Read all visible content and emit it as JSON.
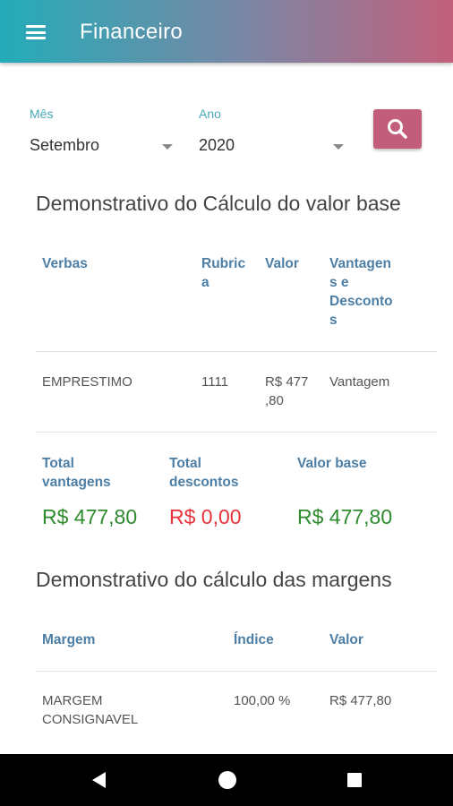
{
  "app_bar": {
    "title": "Financeiro"
  },
  "filters": {
    "month": {
      "label": "Mês",
      "value": "Setembro"
    },
    "year": {
      "label": "Ano",
      "value": "2020"
    }
  },
  "section1": {
    "title": "Demonstrativo do Cálculo do valor base",
    "headers": [
      "Verbas",
      "Rubrica",
      "Valor",
      "Vantagens e Descontos"
    ],
    "header_display": [
      "Verbas",
      "Rubric\na",
      "Valor",
      "Vantagen\ns e\nDesconto\ns"
    ],
    "rows": [
      {
        "verba": "EMPRESTIMO",
        "rubrica": "1111",
        "valor": "R$ 477\n,80",
        "tipo": "Vantagem"
      }
    ]
  },
  "totals": {
    "vantagens": {
      "label": "Total\nvantagens",
      "value": "R$ 477,80"
    },
    "descontos": {
      "label": "Total\ndescontos",
      "value": "R$ 0,00"
    },
    "valor_base": {
      "label": "Valor base",
      "value": "R$ 477,80"
    }
  },
  "section2": {
    "title": "Demonstrativo do cálculo das margens",
    "headers": [
      "Margem",
      "Índice",
      "Valor"
    ],
    "rows": [
      {
        "margem": "MARGEM\nCONSIGNAVEL",
        "indice": "100,00 %",
        "valor": "R$ 477,80"
      }
    ]
  },
  "colors": {
    "header_text": "#4d7fa6",
    "positive": "#2e8b2e",
    "negative": "#e8333a",
    "accent": "#c25d7c",
    "label": "#4aa8b8"
  }
}
